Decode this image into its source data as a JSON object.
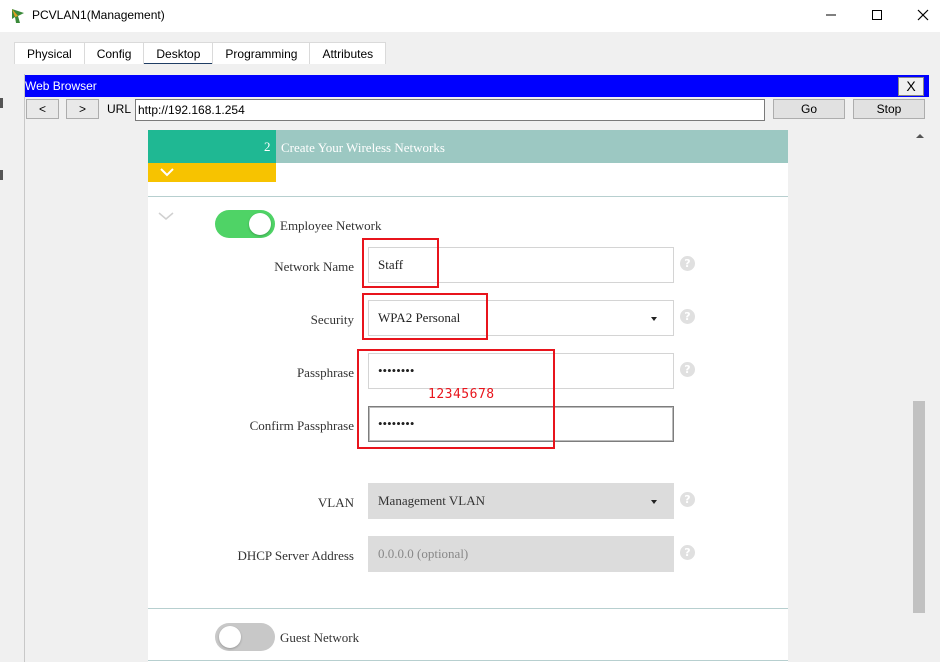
{
  "window": {
    "title": "PCVLAN1(Management)",
    "minimize": "—",
    "maximize": "☐",
    "close": "✕"
  },
  "tabs": [
    {
      "label": "Physical"
    },
    {
      "label": "Config"
    },
    {
      "label": "Desktop",
      "active": true
    },
    {
      "label": "Programming"
    },
    {
      "label": "Attributes"
    }
  ],
  "browser": {
    "title": "Web Browser",
    "close": "X",
    "back": "<",
    "forward": ">",
    "url_label": "URL",
    "url": "http://192.168.1.254",
    "go": "Go",
    "stop": "Stop"
  },
  "page": {
    "step_number": "2",
    "step_title": "Create Your Wireless Networks",
    "employee_network": {
      "label": "Employee Network",
      "enabled": true,
      "network_name_label": "Network Name",
      "network_name": "Staff",
      "security_label": "Security",
      "security": "WPA2 Personal",
      "passphrase_label": "Passphrase",
      "passphrase": "••••••••",
      "confirm_label": "Confirm Passphrase",
      "confirm": "••••••••",
      "vlan_label": "VLAN",
      "vlan": "Management VLAN",
      "dhcp_label": "DHCP Server Address",
      "dhcp_placeholder": "0.0.0.0 (optional)"
    },
    "guest_network": {
      "label": "Guest Network",
      "enabled": false
    },
    "help_glyph": "?"
  },
  "annotation": {
    "passphrase_note": "12345678",
    "color": "#e8141c"
  },
  "colors": {
    "accent_green": "#1fb893",
    "header_bar": "#9cc8c2",
    "yellow_tab": "#f7c300",
    "toggle_on": "#4fd366",
    "browser_title_bg": "#0000ff"
  }
}
